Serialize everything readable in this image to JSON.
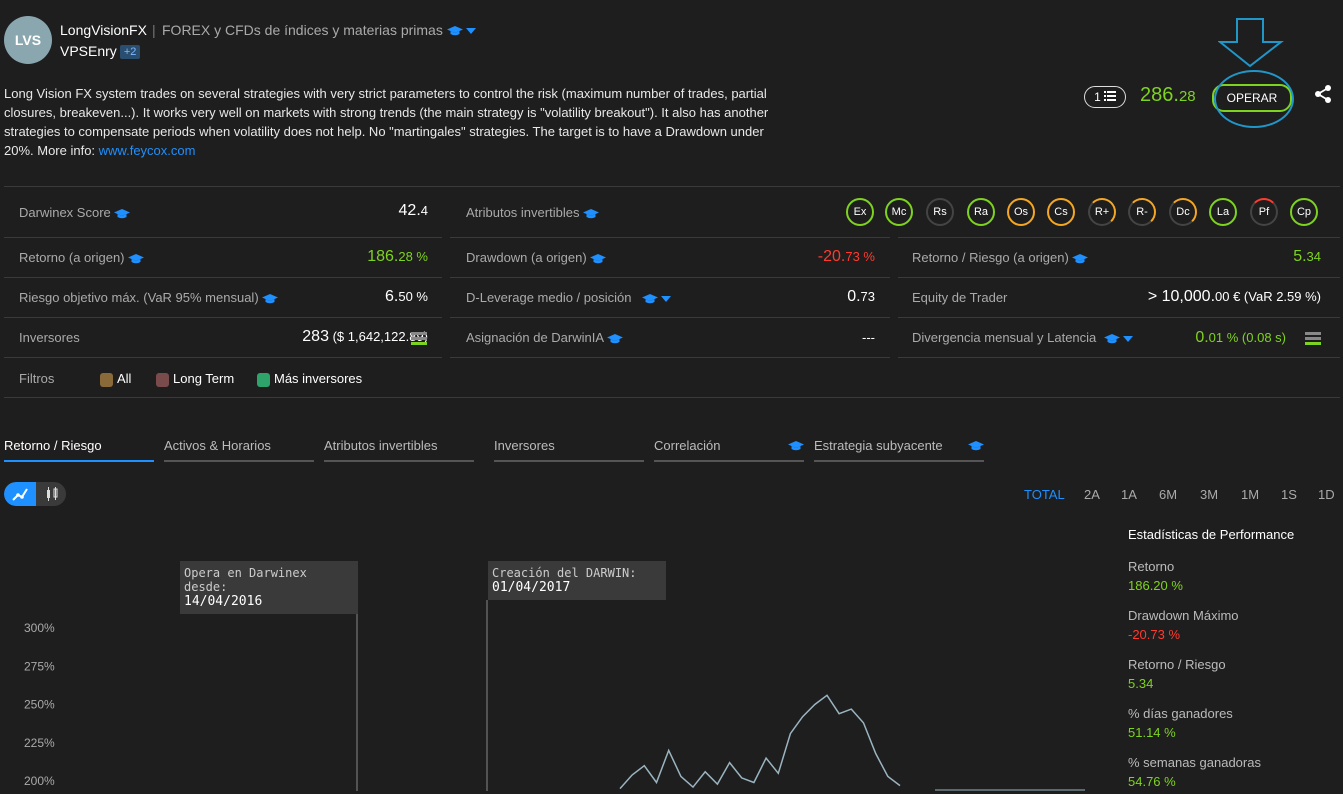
{
  "header": {
    "avatar_initials": "LVS",
    "name": "LongVisionFX",
    "separator": "|",
    "subtitle": "FOREX y CFDs de índices y materias primas",
    "owner": "VPSEnry",
    "owner_badge": "+2"
  },
  "description": {
    "text": "Long Vision FX system trades on several strategies with very strict parameters to control the risk (maximum number of trades, partial closures, breakeven...). It works very well on markets with strong trends (the main strategy is \"volatility breakout\"). It also has another strategies to compensate periods when volatility does not help. No \"martingales\" strategies. The target is to have a Drawdown under 20%. More info: ",
    "link": "www.feycox.com"
  },
  "actions": {
    "list_count": "1",
    "price_main": "286.",
    "price_decimals": "28",
    "operar_label": "OPERAR"
  },
  "metrics": {
    "darwinex_score": {
      "label": "Darwinex Score",
      "value_main": "42.",
      "value_dec": "4"
    },
    "atributos": {
      "label": "Atributos invertibles"
    },
    "retorno": {
      "label": "Retorno (a origen)",
      "value_main": "186.",
      "value_dec": "28 %"
    },
    "drawdown": {
      "label": "Drawdown (a origen)",
      "value_main": "-20.",
      "value_dec": "73 %"
    },
    "retorno_riesgo": {
      "label": "Retorno / Riesgo (a origen)",
      "value_main": "5.",
      "value_dec": "34"
    },
    "riesgo": {
      "label": "Riesgo objetivo máx. (VaR 95% mensual)",
      "value_main": "6.",
      "value_dec": "50 %"
    },
    "dleverage": {
      "label": "D-Leverage medio / posición",
      "value_main": "0.",
      "value_dec": "73"
    },
    "equity": {
      "label": "Equity de Trader",
      "value_main": "> 10,000.",
      "value_dec": "00 € (VaR 2.59 %)"
    },
    "inversores": {
      "label": "Inversores",
      "value_main": "283",
      "value_dec": "($ 1,642,122.89)"
    },
    "asignacion": {
      "label": "Asignación de DarwinIA",
      "value": "---"
    },
    "divergencia": {
      "label": "Divergencia mensual y Latencia",
      "value_main": "0.",
      "value_dec": "01 % (0.08 s)"
    }
  },
  "attributes": [
    "Ex",
    "Mc",
    "Rs",
    "Ra",
    "Os",
    "Cs",
    "R+",
    "R-",
    "Dc",
    "La",
    "Pf",
    "Cp"
  ],
  "filters": {
    "label": "Filtros",
    "items": [
      "All",
      "Long Term",
      "Más inversores"
    ]
  },
  "tabs": [
    "Retorno / Riesgo",
    "Activos & Horarios",
    "Atributos invertibles",
    "Inversores",
    "Correlación",
    "Estrategia subyacente"
  ],
  "periods": [
    "TOTAL",
    "2A",
    "1A",
    "6M",
    "3M",
    "1M",
    "1S",
    "1D"
  ],
  "chart": {
    "note1_title": "Opera en Darwinex desde:",
    "note1_date": "14/04/2016",
    "note2_title": "Creación del DARWIN:",
    "note2_date": "01/04/2017",
    "y_ticks": [
      "300%",
      "275%",
      "250%",
      "225%",
      "200%"
    ]
  },
  "chart_data": {
    "type": "line",
    "title": "",
    "xlabel": "",
    "ylabel": "",
    "y_ticks": [
      "300%",
      "275%",
      "250%",
      "225%",
      "200%"
    ],
    "ylim_visible": [
      200,
      300
    ],
    "series": [
      {
        "values": [
          195,
          204,
          210,
          199,
          220,
          203,
          196,
          206,
          198,
          212,
          202,
          199,
          215,
          205,
          231,
          242,
          250,
          256,
          244,
          247,
          238,
          218,
          203,
          197
        ]
      }
    ],
    "color": "#9ab4c0"
  },
  "stats": {
    "title": "Estadísticas de Performance",
    "items": [
      {
        "label": "Retorno",
        "value": "186.20 %",
        "color": "#7ed321"
      },
      {
        "label": "Drawdown Máximo",
        "value": "-20.73 %",
        "color": "#ff3b30"
      },
      {
        "label": "Retorno / Riesgo",
        "value": "5.34",
        "color": "#7ed321"
      },
      {
        "label": "% días ganadores",
        "value": "51.14 %",
        "color": "#7ed321"
      },
      {
        "label": "% semanas ganadoras",
        "value": "54.76 %",
        "color": "#7ed321"
      }
    ]
  },
  "colors": {
    "accent": "#1e90ff",
    "positive": "#7ed321",
    "negative": "#ff3b30",
    "annotation": "#2196c9"
  }
}
